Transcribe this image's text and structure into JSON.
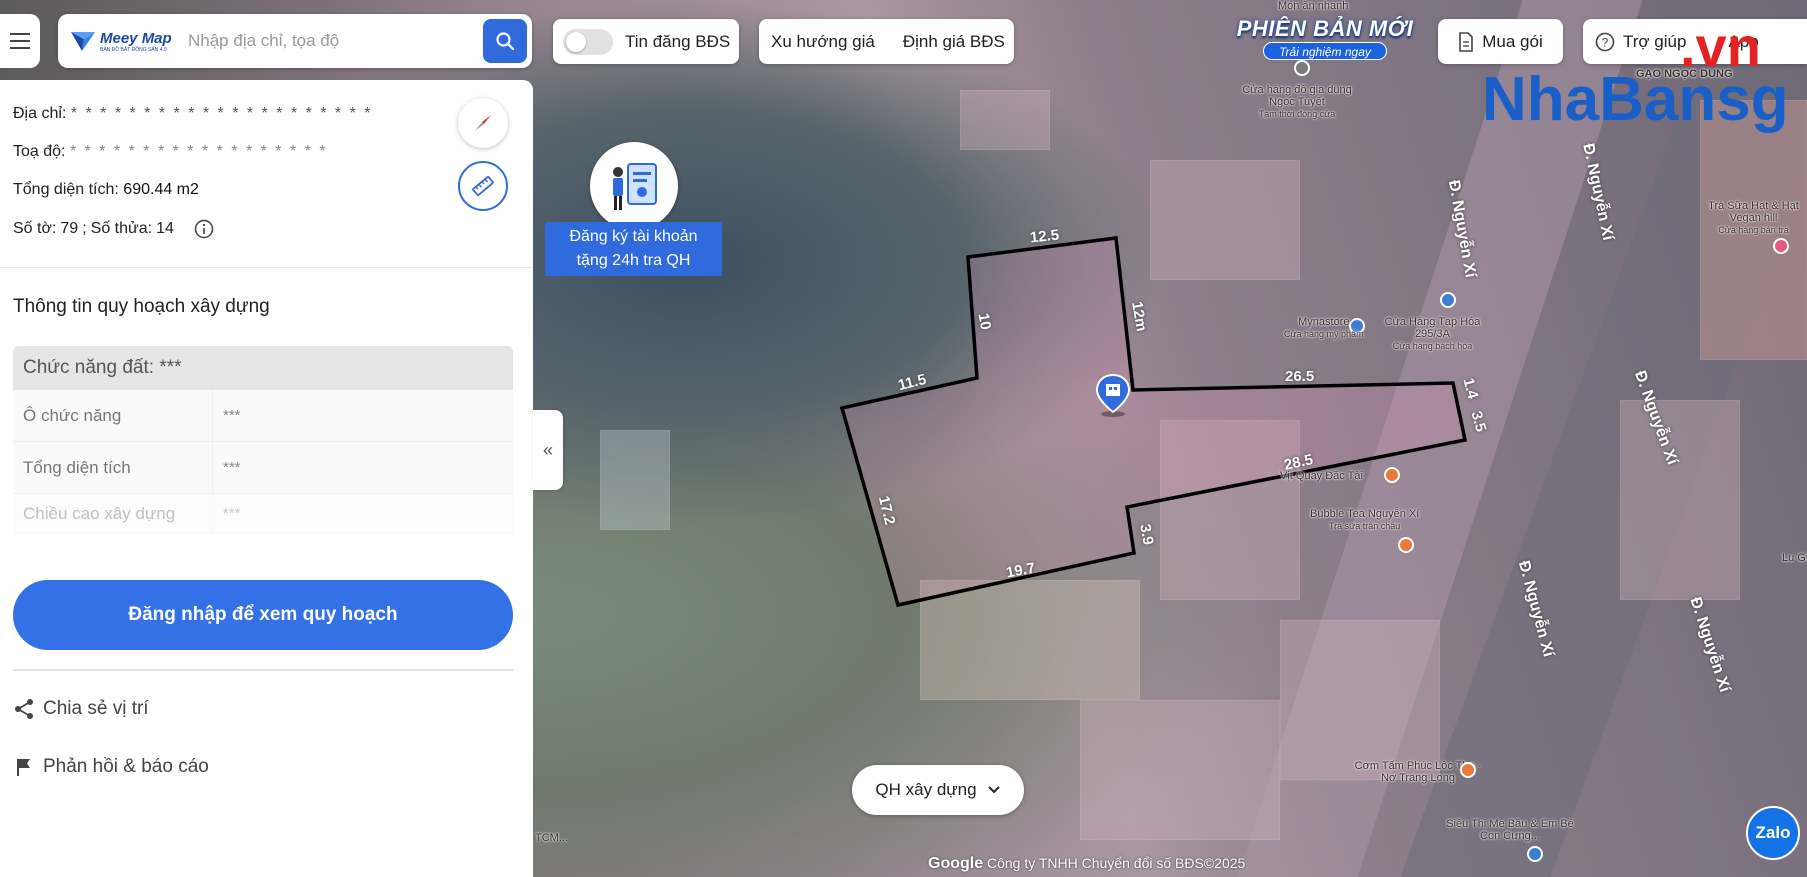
{
  "app": {
    "logo_name": "Meey Map",
    "logo_tag": "BẢN ĐỒ BẤT ĐỘNG SẢN 4.0"
  },
  "search": {
    "placeholder": "Nhập địa chỉ, tọa độ"
  },
  "toolbar": {
    "listing_toggle_label": "Tin đăng BĐS",
    "listing_toggle_on": false,
    "price_trend_label": "Xu hướng giá",
    "valuation_label": "Định giá BĐS",
    "promo_title": "PHIÊN BẢN MỚI",
    "promo_subtitle": "Trải nghiệm ngay",
    "buy_package_label": "Mua gói",
    "help_label": "Trợ giúp",
    "app_label": "App"
  },
  "watermark": {
    "name": "NhaBansg",
    "suffix": ".vn"
  },
  "panel": {
    "address_label": "Địa chỉ:",
    "address_value": "* * * * * * * * * * * * * * * * * * * * *",
    "coords_label": "Toạ độ:",
    "coords_value": "* * * * * * * * * * * * * * * * * *",
    "area_label": "Tổng diện tích:",
    "area_value": "690.44 m2",
    "sheet_label": "Số tờ:",
    "sheet_value": "79",
    "parcel_label": "Số thửa:",
    "parcel_value": "14",
    "section_title": "Thông tin quy hoạch xây dựng",
    "table_header": "Chức năng đất: ***",
    "rows": [
      {
        "key": "Ô chức năng",
        "value": "***"
      },
      {
        "key": "Tổng diện tích",
        "value": "***"
      },
      {
        "key": "Chiều cao xây dựng",
        "value": "***"
      }
    ],
    "login_button": "Đăng nhập để xem quy hoạch",
    "share_label": "Chia sẻ vị trí",
    "report_label": "Phản hồi & báo cáo",
    "collapse_glyph": "«"
  },
  "register_banner": {
    "line1": "Đăng ký tài khoản",
    "line2": "tặng 24h tra QH"
  },
  "map": {
    "layer_select": "QH xây dựng",
    "attribution_google": "Google",
    "attribution_text": "Công ty TNHH Chuyển đổi số BĐS©2025",
    "zalo_label": "Zalo",
    "street_labels": [
      "Đ. Nguyễn Xí",
      "Đ. Nguyễn Xí",
      "Đ. Nguyễn Xí",
      "Đ. Nguyễn Xí",
      "Đ. Nguyễn Xí"
    ],
    "dimensions": [
      "12.5",
      "12m",
      "10",
      "11.5",
      "26.5",
      "1.4",
      "3.5",
      "28.5",
      "17.2",
      "3.9",
      "19.7"
    ],
    "pois": [
      {
        "name": "Món ăn nhanh",
        "sub": ""
      },
      {
        "name": "GẠO NGỌC DUNG",
        "sub": ""
      },
      {
        "name": "Cửa hàng đồ gia dụng Ngọc Tuyết",
        "sub": "Tạm thời đóng cửa"
      },
      {
        "name": "Mynastore",
        "sub": "Cửa hàng mỹ phẩm"
      },
      {
        "name": "Cửa Hàng Tạp Hóa 295/3A",
        "sub": "Cửa hàng bách hóa"
      },
      {
        "name": "Trà Sữa Hạt & Hạt Vegan hill",
        "sub": "Cửa hàng bán trà"
      },
      {
        "name": "Vịt Quay Đặc Tài",
        "sub": ""
      },
      {
        "name": "Bubble Tea Nguyễn Xí",
        "sub": "Trà sữa trân châu"
      },
      {
        "name": "Cơm Tấm Phúc Lộc Thọ - Nơ Trang Long",
        "sub": ""
      },
      {
        "name": "Siêu Thị Mẹ Bầu & Em Bé Con Cưng...",
        "sub": ""
      },
      {
        "name": "Lu Gi",
        "sub": ""
      },
      {
        "name": "TCM...",
        "sub": ""
      }
    ]
  },
  "colors": {
    "accent": "#2f6bdc",
    "parcel_outline": "#000000",
    "watermark": "#1a5fc7",
    "watermark_suffix": "#e32222"
  }
}
